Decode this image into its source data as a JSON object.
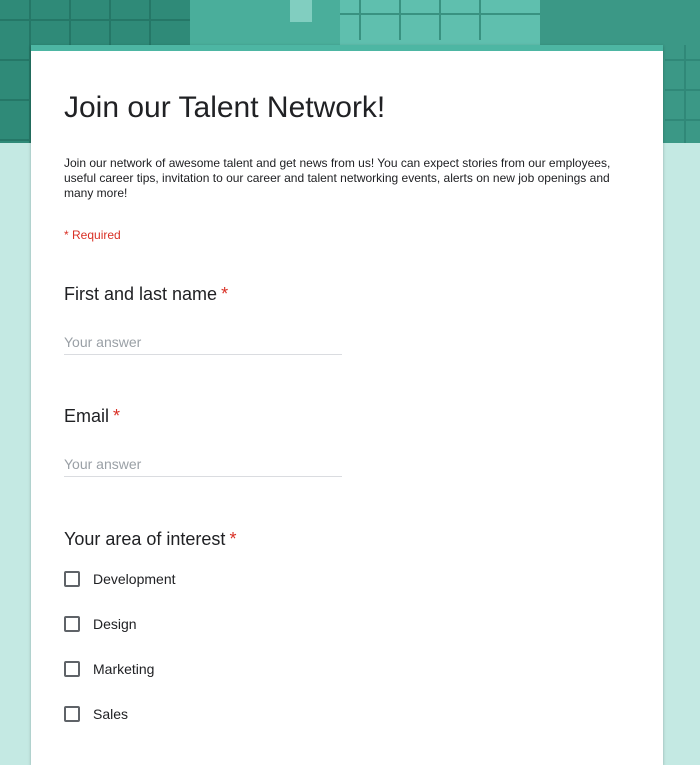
{
  "form": {
    "title": "Join our Talent Network!",
    "description": "Join our network of awesome talent and get news from us! You can expect stories from our employees, useful career tips, invitation to our career and talent networking events, alerts on new job openings and many more!",
    "required_note": "* Required"
  },
  "questions": {
    "name": {
      "label": "First and last name",
      "required_mark": "*",
      "placeholder": "Your answer"
    },
    "email": {
      "label": "Email",
      "required_mark": "*",
      "placeholder": "Your answer"
    },
    "interest": {
      "label": "Your area of interest",
      "required_mark": "*",
      "options": [
        "Development",
        "Design",
        "Marketing",
        "Sales"
      ]
    }
  },
  "colors": {
    "page_background": "#c4e9e3",
    "banner": "#3fa28f",
    "accent": "#4db6a3",
    "required": "#d93025"
  }
}
